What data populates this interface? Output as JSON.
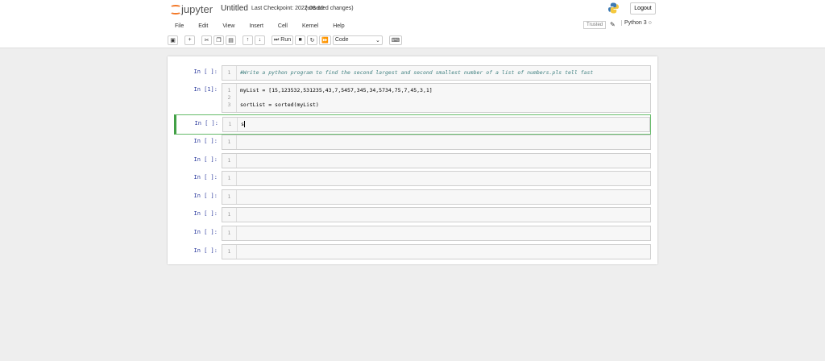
{
  "header": {
    "logo": "jupyter",
    "title": "Untitled",
    "checkpoint": "Last Checkpoint: 2022-06-10",
    "status": "(unsaved changes)",
    "logout": "Logout"
  },
  "menu": [
    "File",
    "Edit",
    "View",
    "Insert",
    "Cell",
    "Kernel",
    "Help"
  ],
  "kernel": {
    "trusted": "Trusted",
    "name": "Python 3"
  },
  "toolbar": {
    "run": "Run",
    "cell_type": "Code"
  },
  "cells": [
    {
      "prompt": "In [ ]:",
      "lines": [
        "1"
      ],
      "code": "#Write a python program to find the second largest and second smallest number of a list of numbers.pls tell fast"
    },
    {
      "prompt": "In [1]:",
      "lines": [
        "1",
        "2",
        "3"
      ],
      "code_line1": "myList = [15,123532,531235,43,7,5457,345,34,5734,75,7,45,3,1]",
      "code_line3": "sortList = sorted(myList)"
    },
    {
      "prompt": "In [ ]:",
      "lines": [
        "1"
      ],
      "code": "s"
    },
    {
      "prompt": "In [ ]:",
      "lines": [
        "1"
      ]
    },
    {
      "prompt": "In [ ]:",
      "lines": [
        "1"
      ]
    },
    {
      "prompt": "In [ ]:",
      "lines": [
        "1"
      ]
    },
    {
      "prompt": "In [ ]:",
      "lines": [
        "1"
      ]
    },
    {
      "prompt": "In [ ]:",
      "lines": [
        "1"
      ]
    },
    {
      "prompt": "In [ ]:",
      "lines": [
        "1"
      ]
    },
    {
      "prompt": "In [ ]:",
      "lines": [
        "1"
      ]
    }
  ]
}
